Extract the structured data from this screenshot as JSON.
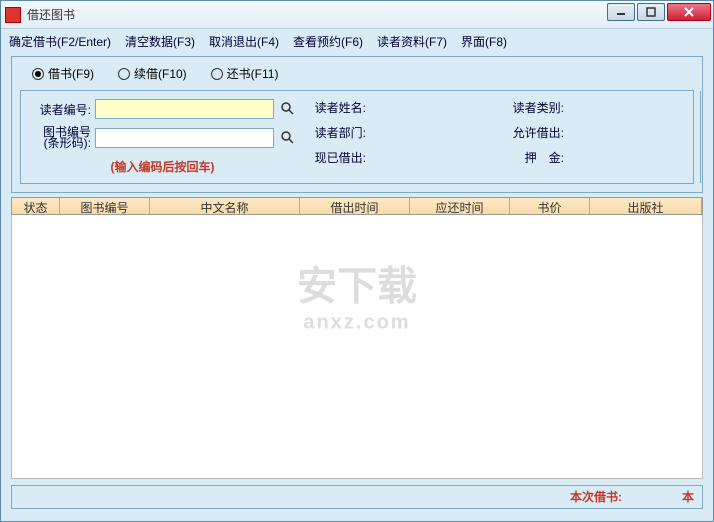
{
  "window": {
    "title": "借还图书"
  },
  "menu": {
    "confirm": "确定借书(F2/Enter)",
    "clear": "清空数据(F3)",
    "cancel": "取消退出(F4)",
    "reserve": "查看预约(F6)",
    "reader": "读者资料(F7)",
    "ui": "界面(F8)"
  },
  "radios": {
    "borrow": "借书(F9)",
    "renew": "续借(F10)",
    "return": "还书(F11)"
  },
  "form": {
    "reader_id_label": "读者编号:",
    "book_id_label_l1": "图书编号",
    "book_id_label_l2": "(条形码):",
    "hint": "(输入编码后按回车)",
    "reader_name_label": "读者姓名:",
    "reader_dept_label": "读者部门:",
    "already_lent_label": "现已借出:",
    "reader_type_label": "读者类别:",
    "allow_lend_label": "允许借出:",
    "deposit_label": "押　金:",
    "reader_id": "",
    "book_id": "",
    "reader_name": "",
    "reader_dept": "",
    "already_lent": "",
    "reader_type": "",
    "allow_lend": "",
    "deposit": ""
  },
  "table": {
    "headers": {
      "status": "状态",
      "book_id": "图书编号",
      "zh_name": "中文名称",
      "lend_time": "借出时间",
      "due_time": "应还时间",
      "price": "书价",
      "publisher": "出版社"
    }
  },
  "footer": {
    "label": "本次借书:",
    "unit": "本"
  },
  "watermark": {
    "main": "安下载",
    "sub": "anxz.com"
  }
}
